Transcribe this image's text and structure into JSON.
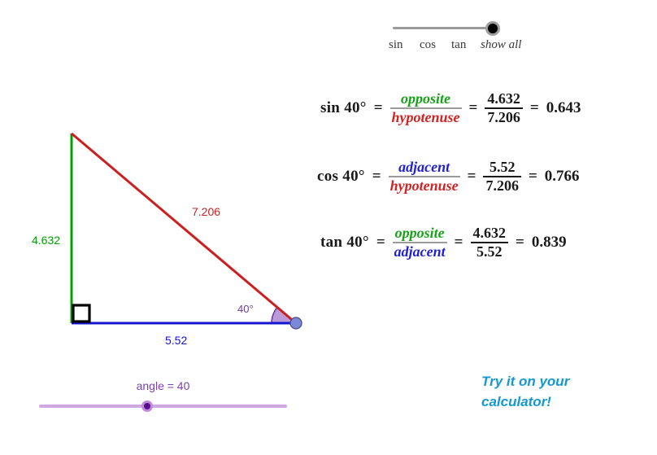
{
  "mode_slider": {
    "options": [
      "sin",
      "cos",
      "tan",
      "show all"
    ],
    "selected": "show all",
    "handle_position_percent": 100
  },
  "equations": [
    {
      "lhs": "sin 40°",
      "eq1": "=",
      "ratio_numerator": "opposite",
      "ratio_denominator": "hypotenuse",
      "ratio_numerator_color": "#17a317",
      "ratio_denominator_color": "#d42121",
      "eq2": "=",
      "value_numerator": "4.632",
      "value_denominator": "7.206",
      "eq3": "=",
      "result": "0.643"
    },
    {
      "lhs": "cos 40°",
      "eq1": "=",
      "ratio_numerator": "adjacent",
      "ratio_denominator": "hypotenuse",
      "ratio_numerator_color": "#2020d8",
      "ratio_denominator_color": "#d42121",
      "eq2": "=",
      "value_numerator": "5.52",
      "value_denominator": "7.206",
      "eq3": "=",
      "result": "0.766"
    },
    {
      "lhs": "tan 40°",
      "eq1": "=",
      "ratio_numerator": "opposite",
      "ratio_denominator": "adjacent",
      "ratio_numerator_color": "#17a317",
      "ratio_denominator_color": "#2020d8",
      "eq2": "=",
      "value_numerator": "4.632",
      "value_denominator": "5.52",
      "eq3": "=",
      "result": "0.839"
    }
  ],
  "triangle": {
    "angle_label": "40°",
    "opposite_label": "4.632",
    "adjacent_label": "5.52",
    "hypotenuse_label": "7.206",
    "opposite_color": "#00a000",
    "adjacent_color": "#1414d2",
    "hypotenuse_color": "#cc2020",
    "arc_fill_color": "#b088d0",
    "arc_stroke_color": "#6b3fa0",
    "vertex_dot_color": "#7b8ad8",
    "right_angle_marker_color": "#000000"
  },
  "angle_slider": {
    "label": "angle = 40",
    "value": 40,
    "min": 0,
    "max": 90,
    "handle_position_percent": 43
  },
  "cta": {
    "line1": "Try it on your",
    "line2": "calculator!",
    "color": "#1598d2"
  }
}
